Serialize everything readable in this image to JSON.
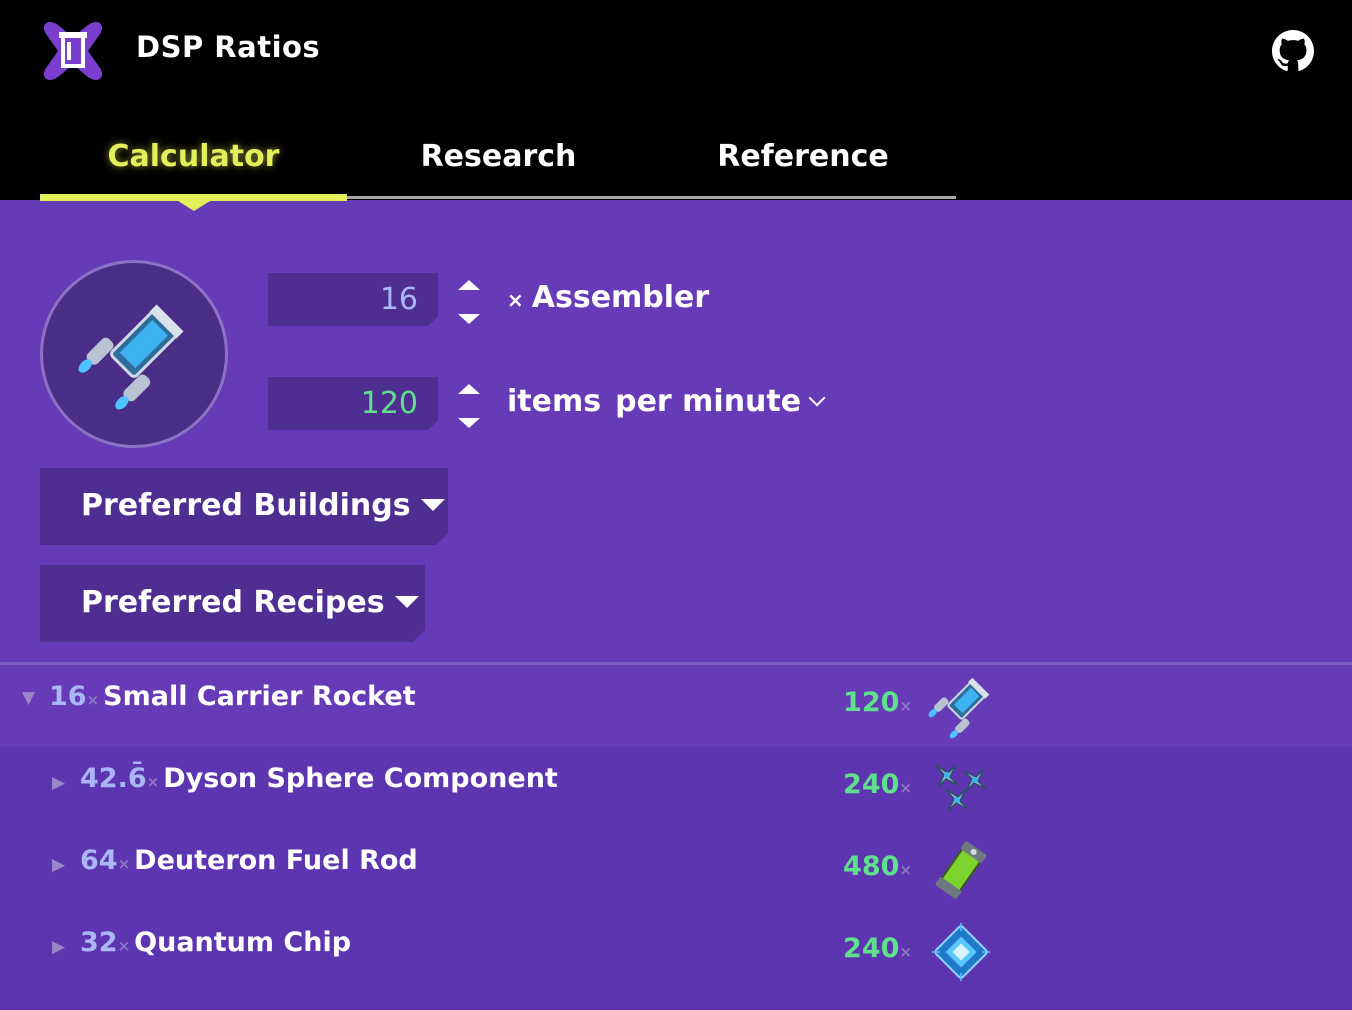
{
  "app": {
    "title": "DSP Ratios",
    "logo_icon": "dsp-ratios-logo",
    "github_icon": "github-icon"
  },
  "tabs": [
    {
      "label": "Calculator",
      "active": true
    },
    {
      "label": "Research",
      "active": false
    },
    {
      "label": "Reference",
      "active": false
    }
  ],
  "calculator": {
    "item_icon": "small-carrier-rocket-icon",
    "building_count": "16",
    "building_label": "Assembler",
    "rate_value": "120",
    "items_label": "items",
    "rate_unit": "per minute",
    "preferred_buildings_label": "Preferred Buildings",
    "preferred_recipes_label": "Preferred Recipes"
  },
  "results": {
    "root": {
      "count": "16",
      "name": "Small Carrier Rocket",
      "rate": "120",
      "icon": "small-carrier-rocket-icon",
      "expanded": true
    },
    "children": [
      {
        "count": "42.6̄",
        "name": "Dyson Sphere Component",
        "rate": "240",
        "icon": "dyson-sphere-component-icon",
        "expanded": false
      },
      {
        "count": "64",
        "name": "Deuteron Fuel Rod",
        "rate": "480",
        "icon": "deuteron-fuel-rod-icon",
        "expanded": false
      },
      {
        "count": "32",
        "name": "Quantum Chip",
        "rate": "240",
        "icon": "quantum-chip-icon",
        "expanded": false
      }
    ]
  },
  "symbols": {
    "times": "×",
    "collapsed": "▶",
    "expanded": "▼"
  },
  "colors": {
    "background": "#673ab7",
    "header": "#000000",
    "accent": "#e4f05a",
    "rate_green": "#5fe08d",
    "count_blue": "#aab6f5"
  }
}
